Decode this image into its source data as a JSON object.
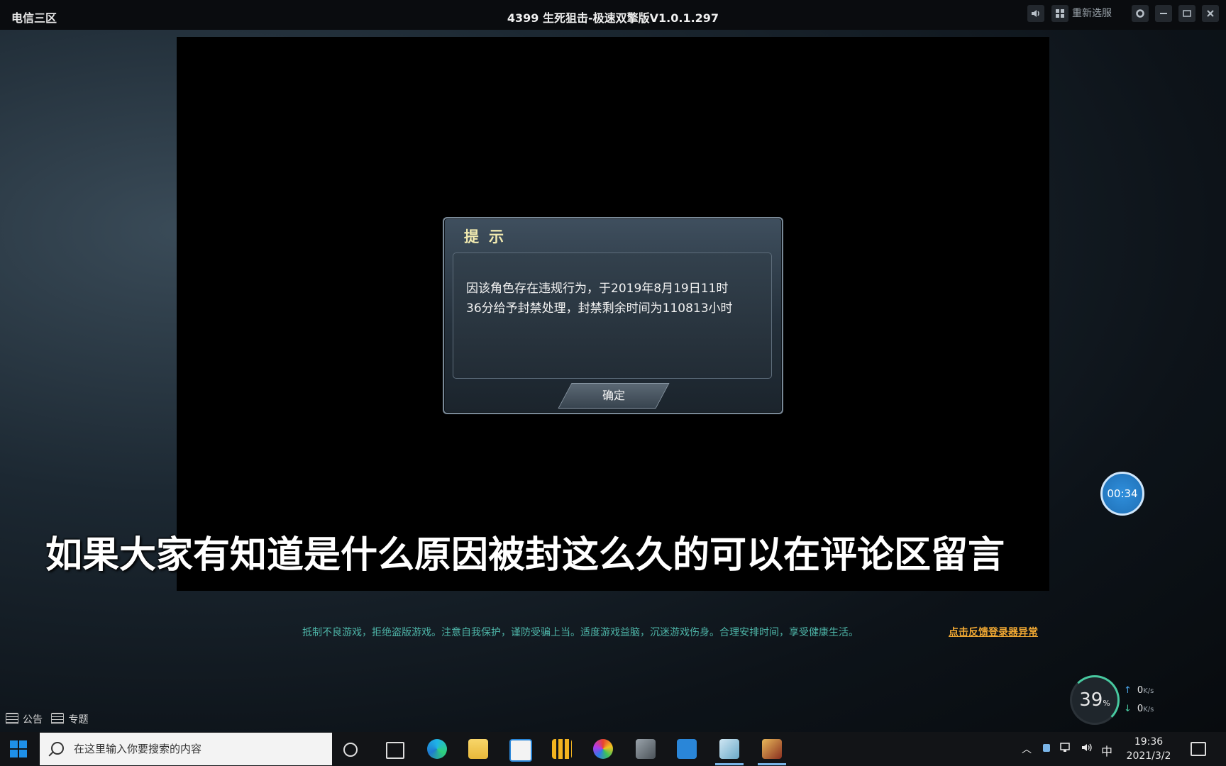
{
  "window": {
    "server": "电信三区",
    "title": "4399 生死狙击-极速双擎版V1.0.1.297",
    "reselect_label": "重新选服"
  },
  "dialog": {
    "title": "提示",
    "message_line1": "因该角色存在违规行为，于2019年8月19日11时",
    "message_line2": "36分给予封禁处理，封禁剩余时间为110813小时",
    "ok_label": "确定"
  },
  "subtitle": "如果大家有知道是什么原因被封这么久的可以在评论区留言",
  "timer": "00:34",
  "footer": {
    "notice": "抵制不良游戏，拒绝盗版游戏。注意自我保护，谨防受骗上当。适度游戏益脑，沉迷游戏伤身。合理安排时间，享受健康生活。",
    "feedback_link": "点击反馈登录器异常"
  },
  "perf": {
    "cpu_value": "39",
    "cpu_unit": "%",
    "up_value": "0",
    "down_value": "0",
    "rate_unit": "K/s"
  },
  "infobar": {
    "announcement": "公告",
    "topic": "专题"
  },
  "taskbar": {
    "search_placeholder": "在这里输入你要搜索的内容",
    "ime": "中",
    "time": "19:36",
    "date": "2021/3/2"
  },
  "colors": {
    "accent_teal": "#4eb5a8",
    "feedback_orange": "#f0a833",
    "dialog_title": "#f1eab0",
    "timer_blue": "#2f8fdc"
  }
}
